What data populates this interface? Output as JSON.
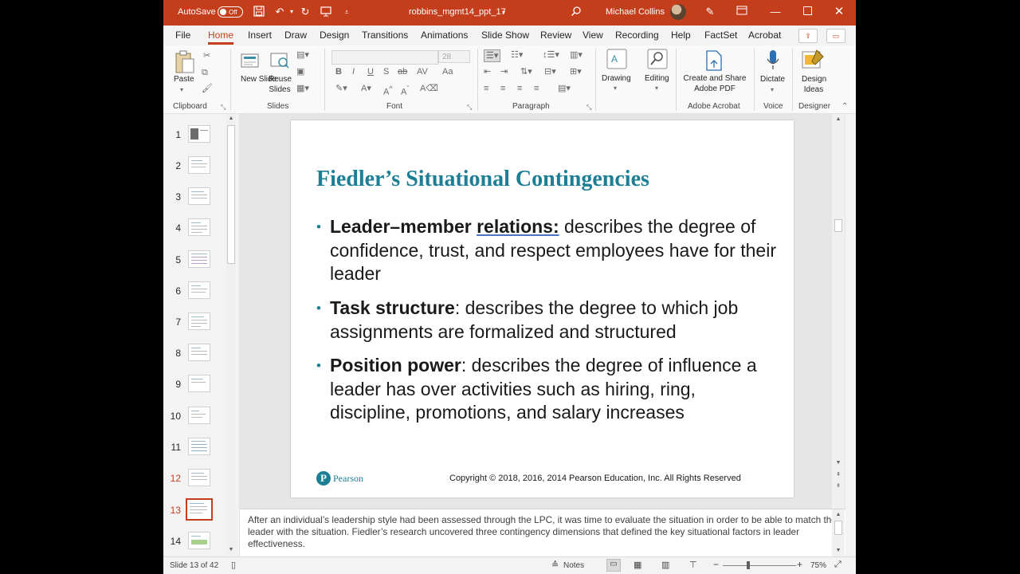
{
  "titlebar": {
    "autosave_label": "AutoSave",
    "autosave_state": "Off",
    "filename": "robbins_mgmt14_ppt_17",
    "user": "Michael Collins",
    "accent": "#c43e1c"
  },
  "tabs": [
    "File",
    "Home",
    "Insert",
    "Draw",
    "Design",
    "Transitions",
    "Animations",
    "Slide Show",
    "Review",
    "View",
    "Recording",
    "Help",
    "FactSet",
    "Acrobat"
  ],
  "active_tab": "Home",
  "ribbon": {
    "clipboard": {
      "paste": "Paste",
      "group": "Clipboard"
    },
    "slides": {
      "new_slide": "New Slide",
      "reuse_slides": "Reuse Slides",
      "group": "Slides"
    },
    "font": {
      "size": "28",
      "group": "Font"
    },
    "paragraph": {
      "group": "Paragraph"
    },
    "editing": {
      "drawing": "Drawing",
      "editing": "Editing"
    },
    "acrobat": {
      "create_share": "Create and Share Adobe PDF",
      "group": "Adobe Acrobat"
    },
    "voice": {
      "dictate": "Dictate",
      "group": "Voice"
    },
    "designer": {
      "design_ideas": "Design Ideas",
      "group": "Designer"
    }
  },
  "thumbnails": [
    "1",
    "2",
    "3",
    "4",
    "5",
    "6",
    "7",
    "8",
    "9",
    "10",
    "11",
    "12",
    "13",
    "14"
  ],
  "selected_slide": "13",
  "slide": {
    "title": "Fiedler’s Situational Contingencies",
    "bullets": [
      {
        "term": "Leader–member ",
        "term_underlined": "relations:",
        "text": " describes the degree of confidence, trust, and respect employees have for their leader"
      },
      {
        "term": "Task structure",
        "term_underlined": "",
        "text": ": describes the degree to which job assignments are formalized and structured"
      },
      {
        "term": "Position power",
        "term_underlined": "",
        "text": ": describes the degree of influence a leader has over activities such as hiring, ring, discipline, promotions, and salary increases"
      }
    ],
    "logo_letter": "P",
    "logo_text": "Pearson",
    "copyright": "Copyright © 2018, 2016, 2014 Pearson Education, Inc. All Rights Reserved"
  },
  "notes": "After an individual’s leadership style had been assessed through the LPC, it was time to evaluate the situation in order to be able to match the leader with the situation. Fiedler’s research uncovered three contingency dimensions that defined the key situational factors in leader effectiveness.",
  "status": {
    "slide_indicator": "Slide 13 of 42",
    "notes_label": "Notes",
    "zoom": "75%"
  }
}
